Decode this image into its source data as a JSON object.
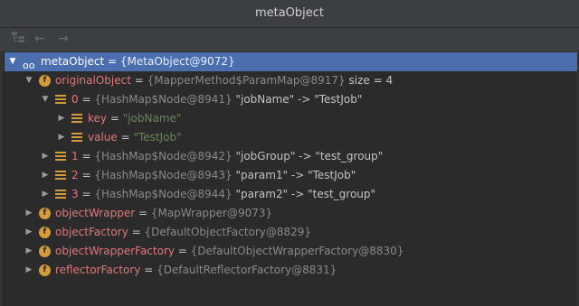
{
  "window": {
    "title": "metaObject"
  },
  "toolbar": {
    "back_arrow": "←",
    "forward_arrow": "→"
  },
  "tree": [
    {
      "depth": 0,
      "expanded": true,
      "icon": "glasses-icon",
      "name": "metaObject",
      "eq": " = ",
      "ref": "{MetaObject@9072}",
      "extra": "",
      "selected": true
    },
    {
      "depth": 1,
      "expanded": true,
      "icon": "field-icon",
      "name": "originalObject",
      "eq": " = ",
      "ref": "{MapperMethod$ParamMap@8917}",
      "extra": "  size = 4",
      "selected": false
    },
    {
      "depth": 2,
      "expanded": true,
      "icon": "entry-icon",
      "name": "0",
      "eq": " = ",
      "ref": "{HashMap$Node@8941}",
      "extra": " \"jobName\" -> \"TestJob\"",
      "selected": false
    },
    {
      "depth": 3,
      "expanded": false,
      "icon": "entry-icon",
      "name": "key",
      "eq": " = ",
      "ref": "",
      "str": "\"jobName\"",
      "extra": "",
      "selected": false
    },
    {
      "depth": 3,
      "expanded": false,
      "icon": "entry-icon",
      "name": "value",
      "eq": " = ",
      "ref": "",
      "str": "\"TestJob\"",
      "extra": "",
      "selected": false
    },
    {
      "depth": 2,
      "expanded": false,
      "icon": "entry-icon",
      "name": "1",
      "eq": " = ",
      "ref": "{HashMap$Node@8942}",
      "extra": " \"jobGroup\" -> \"test_group\"",
      "selected": false
    },
    {
      "depth": 2,
      "expanded": false,
      "icon": "entry-icon",
      "name": "2",
      "eq": " = ",
      "ref": "{HashMap$Node@8943}",
      "extra": " \"param1\" -> \"TestJob\"",
      "selected": false
    },
    {
      "depth": 2,
      "expanded": false,
      "icon": "entry-icon",
      "name": "3",
      "eq": " = ",
      "ref": "{HashMap$Node@8944}",
      "extra": " \"param2\" -> \"test_group\"",
      "selected": false
    },
    {
      "depth": 1,
      "expanded": false,
      "icon": "field-icon",
      "name": "objectWrapper",
      "eq": " = ",
      "ref": "{MapWrapper@9073}",
      "extra": "",
      "selected": false
    },
    {
      "depth": 1,
      "expanded": false,
      "icon": "field-icon",
      "name": "objectFactory",
      "eq": " = ",
      "ref": "{DefaultObjectFactory@8829}",
      "extra": "",
      "selected": false
    },
    {
      "depth": 1,
      "expanded": false,
      "icon": "field-icon",
      "name": "objectWrapperFactory",
      "eq": " = ",
      "ref": "{DefaultObjectWrapperFactory@8830}",
      "extra": "",
      "selected": false
    },
    {
      "depth": 1,
      "expanded": false,
      "icon": "field-icon",
      "name": "reflectorFactory",
      "eq": " = ",
      "ref": "{DefaultReflectorFactory@8831}",
      "extra": "",
      "selected": false
    }
  ],
  "colors": {
    "selection": "#4b6eaf",
    "field_icon": "#d69b3a",
    "name": "#e0787a",
    "string": "#6a8759"
  }
}
